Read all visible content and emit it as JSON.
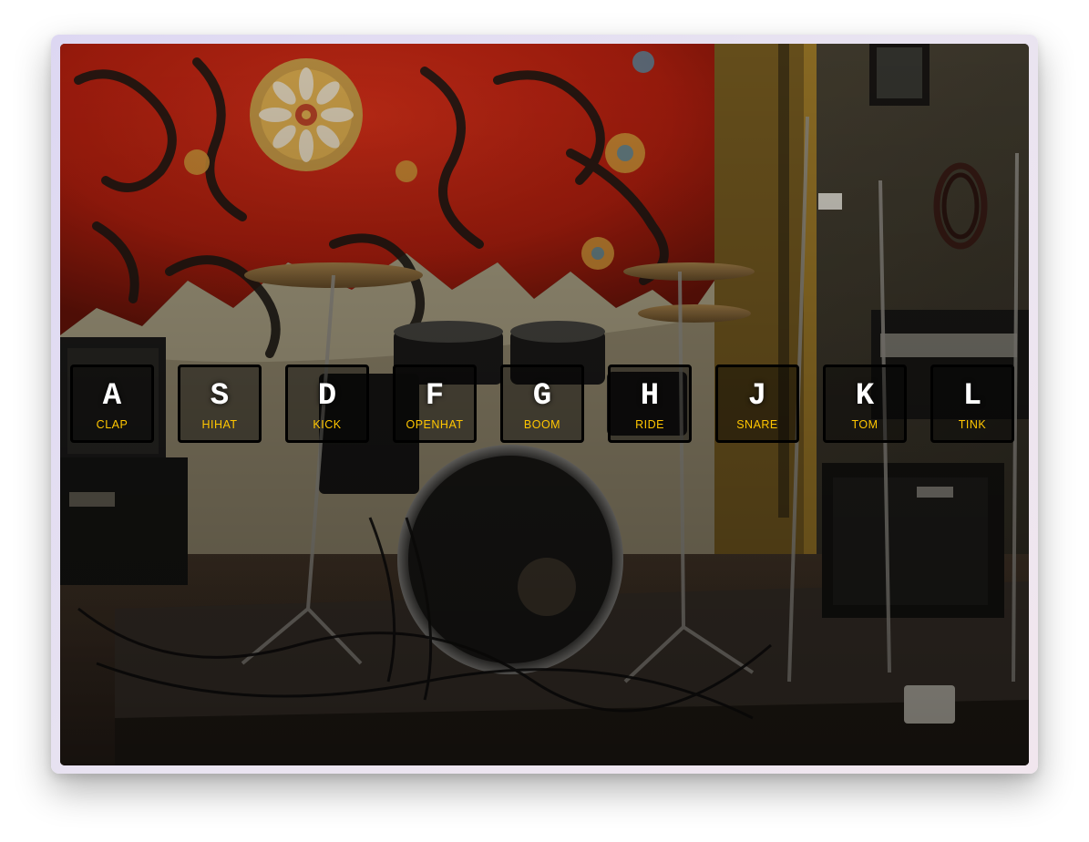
{
  "colors": {
    "key_border": "#000000",
    "key_letter": "#ffffff",
    "key_sound_label": "#ffc600",
    "window_frame": "#e6e0f0"
  },
  "background": {
    "icon": "drum-kit-stage-photo"
  },
  "keys": [
    {
      "letter": "A",
      "sound": "CLAP"
    },
    {
      "letter": "S",
      "sound": "HIHAT"
    },
    {
      "letter": "D",
      "sound": "KICK"
    },
    {
      "letter": "F",
      "sound": "OPENHAT"
    },
    {
      "letter": "G",
      "sound": "BOOM"
    },
    {
      "letter": "H",
      "sound": "RIDE"
    },
    {
      "letter": "J",
      "sound": "SNARE"
    },
    {
      "letter": "K",
      "sound": "TOM"
    },
    {
      "letter": "L",
      "sound": "TINK"
    }
  ]
}
